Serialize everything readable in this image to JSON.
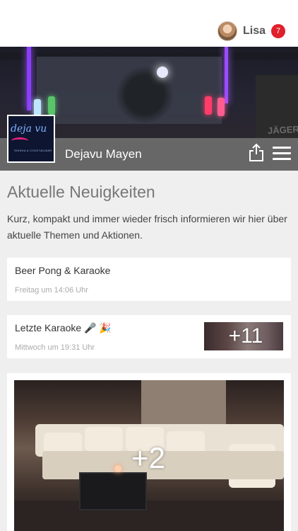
{
  "header": {
    "user_name": "Lisa",
    "notification_count": "7",
    "badge_color": "#e0202b"
  },
  "hero": {
    "venue_name": "Dejavu Mayen",
    "logo_text": "deja vu",
    "logo_subtext": "SHISHA & COCKTAILBAR",
    "sign_text": "JÄGER",
    "share_icon": "share-icon",
    "menu_icon": "hamburger-menu-icon"
  },
  "section": {
    "title": "Aktuelle Neuigkeiten",
    "description": "Kurz, kompakt und immer wieder frisch informieren wir hier über aktuelle Themen und Aktionen."
  },
  "posts": [
    {
      "title": "Beer Pong & Karaoke",
      "time": "Freitag um 14:06 Uhr"
    },
    {
      "title": "Letzte Karaoke 🎤 🎉",
      "time": "Mittwoch um 19:31 Uhr",
      "more_images": "+11"
    },
    {
      "more_images": "+2"
    }
  ]
}
